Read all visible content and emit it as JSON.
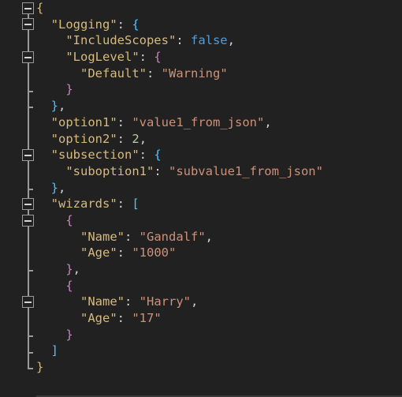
{
  "editor": {
    "language": "json",
    "theme": "dark",
    "background": "#212121",
    "line_count": 24,
    "colors": {
      "key": "#d7ba7d",
      "string": "#ce9178",
      "number": "#b5cea8",
      "boolean": "#569cd6",
      "punctuation": "#d4d4d4",
      "bracket_level_0": "#d7ba7d",
      "bracket_level_1": "#4fc1ff",
      "bracket_level_2": "#c586c0",
      "gutter_guide": "#9a9a9a"
    }
  },
  "gutter": {
    "fold_markers": [
      {
        "name": "fold-marker-root-object",
        "line": 1,
        "state": "expanded",
        "glyph": "minus-square"
      },
      {
        "name": "fold-marker-logging",
        "line": 2,
        "state": "expanded",
        "glyph": "minus-square"
      },
      {
        "name": "fold-marker-loglevel",
        "line": 4,
        "state": "expanded",
        "glyph": "minus-square"
      },
      {
        "name": "fold-marker-subsection",
        "line": 10,
        "state": "expanded",
        "glyph": "minus-square"
      },
      {
        "name": "fold-marker-wizards",
        "line": 13,
        "state": "expanded",
        "glyph": "minus-square"
      },
      {
        "name": "fold-marker-wizard-0",
        "line": 14,
        "state": "expanded",
        "glyph": "minus-square"
      },
      {
        "name": "fold-marker-wizard-1",
        "line": 19,
        "state": "expanded",
        "glyph": "minus-square"
      }
    ]
  },
  "lines": [
    {
      "n": 1,
      "indent": 0,
      "tokens": [
        {
          "t": "{",
          "c": "b0"
        }
      ]
    },
    {
      "n": 2,
      "indent": 1,
      "tokens": [
        {
          "t": "\"Logging\"",
          "c": "key"
        },
        {
          "t": ": ",
          "c": "punct"
        },
        {
          "t": "{",
          "c": "b1"
        }
      ]
    },
    {
      "n": 3,
      "indent": 2,
      "tokens": [
        {
          "t": "\"IncludeScopes\"",
          "c": "key"
        },
        {
          "t": ": ",
          "c": "punct"
        },
        {
          "t": "false",
          "c": "bool"
        },
        {
          "t": ",",
          "c": "punct"
        }
      ]
    },
    {
      "n": 4,
      "indent": 2,
      "tokens": [
        {
          "t": "\"LogLevel\"",
          "c": "key"
        },
        {
          "t": ": ",
          "c": "punct"
        },
        {
          "t": "{",
          "c": "b2"
        }
      ]
    },
    {
      "n": 5,
      "indent": 3,
      "tokens": [
        {
          "t": "\"Default\"",
          "c": "key"
        },
        {
          "t": ": ",
          "c": "punct"
        },
        {
          "t": "\"Warning\"",
          "c": "str"
        }
      ]
    },
    {
      "n": 6,
      "indent": 2,
      "tokens": [
        {
          "t": "}",
          "c": "b2"
        }
      ]
    },
    {
      "n": 7,
      "indent": 1,
      "tokens": [
        {
          "t": "}",
          "c": "b1"
        },
        {
          "t": ",",
          "c": "punct"
        }
      ]
    },
    {
      "n": 8,
      "indent": 1,
      "tokens": [
        {
          "t": "\"option1\"",
          "c": "key"
        },
        {
          "t": ": ",
          "c": "punct"
        },
        {
          "t": "\"value1_from_json\"",
          "c": "str"
        },
        {
          "t": ",",
          "c": "punct"
        }
      ]
    },
    {
      "n": 9,
      "indent": 1,
      "tokens": [
        {
          "t": "\"option2\"",
          "c": "key"
        },
        {
          "t": ": ",
          "c": "punct"
        },
        {
          "t": "2",
          "c": "num"
        },
        {
          "t": ",",
          "c": "punct"
        }
      ]
    },
    {
      "n": 10,
      "indent": 1,
      "tokens": [
        {
          "t": "\"subsection\"",
          "c": "key"
        },
        {
          "t": ": ",
          "c": "punct"
        },
        {
          "t": "{",
          "c": "b1"
        }
      ]
    },
    {
      "n": 11,
      "indent": 2,
      "tokens": [
        {
          "t": "\"suboption1\"",
          "c": "key"
        },
        {
          "t": ": ",
          "c": "punct"
        },
        {
          "t": "\"subvalue1_from_json\"",
          "c": "str"
        }
      ]
    },
    {
      "n": 12,
      "indent": 1,
      "tokens": [
        {
          "t": "}",
          "c": "b1"
        },
        {
          "t": ",",
          "c": "punct"
        }
      ]
    },
    {
      "n": 13,
      "indent": 1,
      "tokens": [
        {
          "t": "\"wizards\"",
          "c": "key"
        },
        {
          "t": ": ",
          "c": "punct"
        },
        {
          "t": "[",
          "c": "b1"
        }
      ]
    },
    {
      "n": 14,
      "indent": 2,
      "tokens": [
        {
          "t": "{",
          "c": "b2"
        }
      ]
    },
    {
      "n": 15,
      "indent": 3,
      "tokens": [
        {
          "t": "\"Name\"",
          "c": "key"
        },
        {
          "t": ": ",
          "c": "punct"
        },
        {
          "t": "\"Gandalf\"",
          "c": "str"
        },
        {
          "t": ",",
          "c": "punct"
        }
      ]
    },
    {
      "n": 16,
      "indent": 3,
      "tokens": [
        {
          "t": "\"Age\"",
          "c": "key"
        },
        {
          "t": ": ",
          "c": "punct"
        },
        {
          "t": "\"1000\"",
          "c": "str"
        }
      ]
    },
    {
      "n": 17,
      "indent": 2,
      "tokens": [
        {
          "t": "}",
          "c": "b2"
        },
        {
          "t": ",",
          "c": "punct"
        }
      ]
    },
    {
      "n": 18,
      "indent": 2,
      "tokens": [
        {
          "t": "{",
          "c": "b2"
        }
      ]
    },
    {
      "n": 19,
      "indent": 3,
      "tokens": [
        {
          "t": "\"Name\"",
          "c": "key"
        },
        {
          "t": ": ",
          "c": "punct"
        },
        {
          "t": "\"Harry\"",
          "c": "str"
        },
        {
          "t": ",",
          "c": "punct"
        }
      ]
    },
    {
      "n": 20,
      "indent": 3,
      "tokens": [
        {
          "t": "\"Age\"",
          "c": "key"
        },
        {
          "t": ": ",
          "c": "punct"
        },
        {
          "t": "\"17\"",
          "c": "str"
        }
      ]
    },
    {
      "n": 21,
      "indent": 2,
      "tokens": [
        {
          "t": "}",
          "c": "b2"
        }
      ]
    },
    {
      "n": 22,
      "indent": 1,
      "tokens": [
        {
          "t": "]",
          "c": "b1"
        }
      ]
    },
    {
      "n": 23,
      "indent": 0,
      "tokens": [
        {
          "t": "}",
          "c": "b0"
        }
      ]
    },
    {
      "n": 24,
      "indent": 0,
      "tokens": []
    }
  ],
  "document_value": {
    "Logging": {
      "IncludeScopes": false,
      "LogLevel": {
        "Default": "Warning"
      }
    },
    "option1": "value1_from_json",
    "option2": 2,
    "subsection": {
      "suboption1": "subvalue1_from_json"
    },
    "wizards": [
      {
        "Name": "Gandalf",
        "Age": "1000"
      },
      {
        "Name": "Harry",
        "Age": "17"
      }
    ]
  }
}
